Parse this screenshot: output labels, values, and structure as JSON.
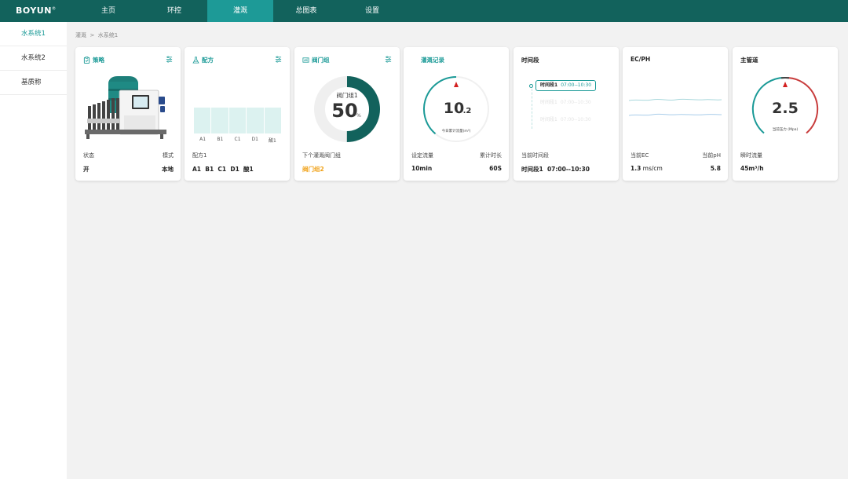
{
  "app": {
    "logo": "BOYUN",
    "logo_mark": "®"
  },
  "nav": {
    "items": [
      "主页",
      "环控",
      "灌溉",
      "总图表",
      "设置"
    ],
    "active": "灌溉"
  },
  "sidebar": {
    "items": [
      "水系统1",
      "水系统2",
      "基质称"
    ],
    "active": "水系统1"
  },
  "breadcrumb": {
    "parent": "灌溉",
    "separator": ">",
    "current": "水系统1"
  },
  "cards": {
    "strategy": {
      "title": "策略",
      "label_left": "状态",
      "label_right": "模式",
      "value_left": "开",
      "value_right": "本地",
      "icon": "clipboard-icon"
    },
    "formula": {
      "title": "配方",
      "bar_labels": [
        "A1",
        "B1",
        "C1",
        "D1",
        "酸1"
      ],
      "label_left": "配方1",
      "value_left": "A1  B1  C1  D1  酸1",
      "icon": "flask-icon"
    },
    "valve": {
      "title": "阀门组",
      "center_label": "阀门组1",
      "percent_value": "50",
      "percent_unit": "%",
      "percent": 50,
      "label_left": "下个灌溉阀门组",
      "value_left": "阀门组2",
      "icon": "valve-icon"
    },
    "irrigation": {
      "title": "灌溉记录",
      "gauge_int": "10",
      "gauge_dec": ".2",
      "gauge_caption": "今日累计流量(m³)",
      "label_left": "设定流量",
      "label_right": "累计时长",
      "value_left": "10min",
      "value_right": "60S"
    },
    "period": {
      "title": "时间段",
      "rows": [
        {
          "name": "时间段1",
          "time": "07:00--10:30",
          "active": true
        },
        {
          "name": "时间段1",
          "time": "07:00--10:30",
          "active": false
        },
        {
          "name": "时间段1",
          "time": "07:00--10:30",
          "active": false
        }
      ],
      "label_left": "当前时间段",
      "value_left": "时间段1  07:00--10:30"
    },
    "ecph": {
      "title": "EC/PH",
      "label_left": "当前EC",
      "label_right": "当前pH",
      "value_left_num": "1.3",
      "value_left_unit": " ms/cm",
      "value_right": "5.8"
    },
    "main_pipe": {
      "title": "主管道",
      "gauge_value": "2.5",
      "gauge_caption": "当前压力 (Mpa)",
      "label_left": "瞬时流量",
      "value_left": "45m³/h"
    }
  },
  "colors": {
    "header": "#12625c",
    "nav_active": "#1d9a97",
    "accent": "#1b9a97",
    "dark_teal": "#12625c",
    "orange": "#f0a21a",
    "red": "#d63a3a"
  }
}
